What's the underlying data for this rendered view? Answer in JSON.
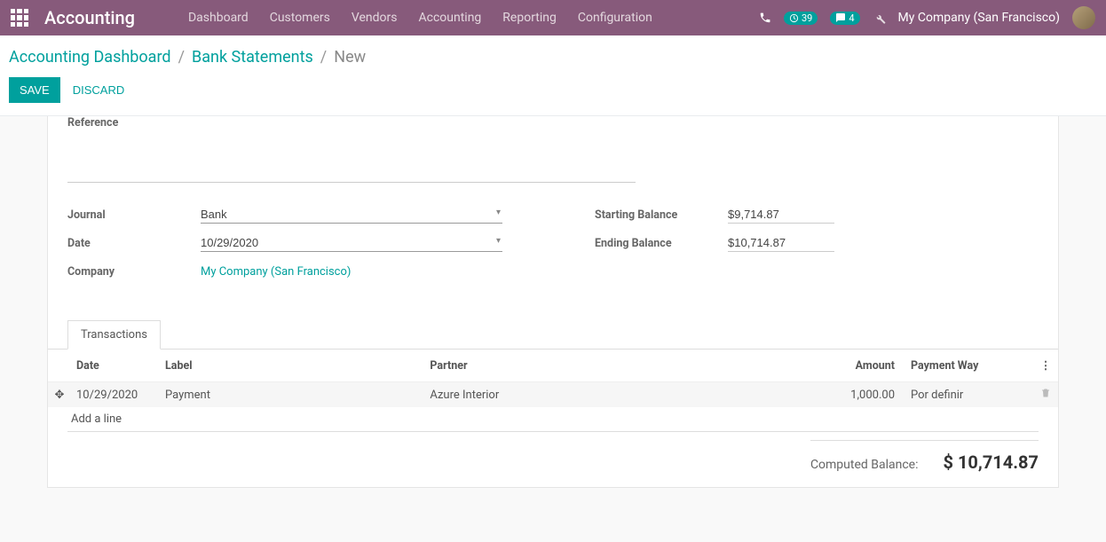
{
  "navbar": {
    "brand": "Accounting",
    "items": [
      "Dashboard",
      "Customers",
      "Vendors",
      "Accounting",
      "Reporting",
      "Configuration"
    ],
    "activity_count": "39",
    "messages_count": "4",
    "company": "My Company (San Francisco)"
  },
  "breadcrumbs": {
    "root": "Accounting Dashboard",
    "mid": "Bank Statements",
    "leaf": "New"
  },
  "actions": {
    "save": "SAVE",
    "discard": "DISCARD"
  },
  "form": {
    "reference_label": "Reference",
    "journal_label": "Journal",
    "journal_value": "Bank",
    "date_label": "Date",
    "date_value": "10/29/2020",
    "company_label": "Company",
    "company_value": "My Company (San Francisco)",
    "starting_label": "Starting Balance",
    "starting_value": "$9,714.87",
    "ending_label": "Ending Balance",
    "ending_value": "$10,714.87"
  },
  "tab": {
    "transactions": "Transactions"
  },
  "table": {
    "headers": {
      "date": "Date",
      "label": "Label",
      "partner": "Partner",
      "amount": "Amount",
      "payment_way": "Payment Way"
    },
    "rows": [
      {
        "date": "10/29/2020",
        "label": "Payment",
        "partner": "Azure Interior",
        "amount": "1,000.00",
        "payment_way": "Por definir"
      }
    ],
    "add_line": "Add a line"
  },
  "totals": {
    "label": "Computed Balance:",
    "value": "$ 10,714.87"
  }
}
